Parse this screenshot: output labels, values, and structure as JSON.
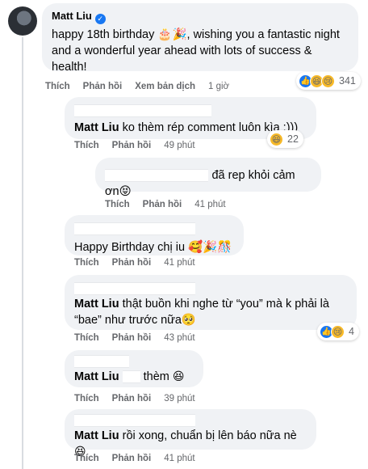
{
  "comment_main": {
    "author": "Matt Liu",
    "text": "happy 18th birthday 🎂🎉, wishing you a fantastic night and a wonderful year ahead with lots of success & health!",
    "actions": {
      "like": "Thích",
      "reply": "Phản hồi",
      "translate": "Xem bản dịch",
      "time": "1 giờ"
    },
    "reactions": {
      "icons": [
        "like",
        "haha",
        "sad"
      ],
      "count": "341"
    }
  },
  "replies": [
    {
      "author": "",
      "mention": "Matt Liu",
      "text": "ko thèm rép comment luôn kìa :)))",
      "actions": {
        "like": "Thích",
        "reply": "Phản hồi",
        "time": "49 phút"
      },
      "reactions": {
        "icons": [
          "haha"
        ],
        "count": "22"
      }
    },
    {
      "author": "",
      "text": "đã rep khỏi cảm ơn😝",
      "actions": {
        "like": "Thích",
        "reply": "Phản hồi",
        "time": "41 phút"
      }
    },
    {
      "author": "",
      "text": "Happy Birthday chị iu 🥰🎉🎊",
      "actions": {
        "like": "Thích",
        "reply": "Phản hồi",
        "time": "41 phút"
      }
    },
    {
      "author": "",
      "mention": "Matt Liu",
      "text": "thật buồn khi nghe từ “you” mà k phải là “bae” như trước nữa🥺",
      "actions": {
        "like": "Thích",
        "reply": "Phản hồi",
        "time": "43 phút"
      },
      "reactions": {
        "icons": [
          "like",
          "sad"
        ],
        "count": "4"
      }
    },
    {
      "author": "",
      "mention": "Matt Liu",
      "text": "thèm",
      "emoji": "😆",
      "actions": {
        "like": "Thích",
        "reply": "Phản hồi",
        "time": "39 phút"
      }
    },
    {
      "author": "",
      "mention": "Matt Liu",
      "text": "rồi xong, chuẩn bị lên báo nữa nè",
      "emoji": "😆",
      "actions": {
        "like": "Thích",
        "reply": "Phản hồi",
        "time": "41 phút"
      }
    }
  ]
}
